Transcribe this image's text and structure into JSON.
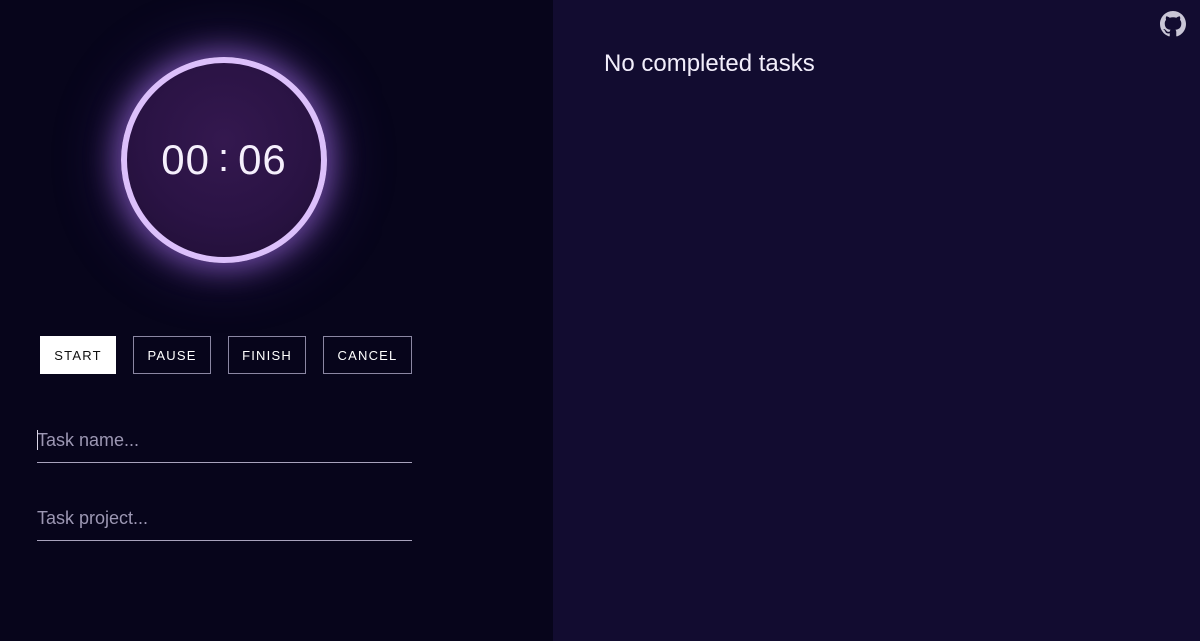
{
  "timer": {
    "minutes": "00",
    "separator": ":",
    "seconds": "06"
  },
  "controls": {
    "start_label": "START",
    "pause_label": "PAUSE",
    "finish_label": "FINISH",
    "cancel_label": "CANCEL"
  },
  "task_form": {
    "name_placeholder": "Task name...",
    "name_value": "",
    "project_placeholder": "Task project...",
    "project_value": ""
  },
  "completed": {
    "empty_message": "No completed tasks"
  },
  "icons": {
    "github": "github-icon"
  },
  "colors": {
    "left_bg": "#07051b",
    "right_bg": "#120c30",
    "ring": "#dcc0fb",
    "ring_glow": "#af78f5",
    "primary_button_bg": "#ffffff"
  }
}
